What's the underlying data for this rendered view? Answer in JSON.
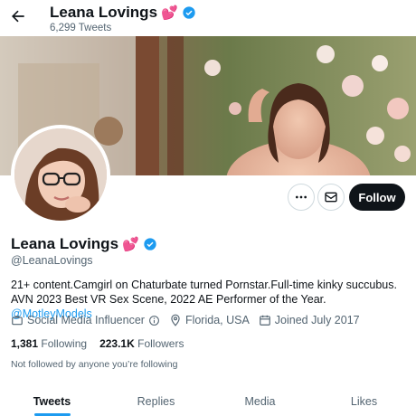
{
  "header": {
    "name": "Leana Lovings",
    "emoji": "💕",
    "tweet_count": "6,299 Tweets"
  },
  "actions": {
    "follow_label": "Follow"
  },
  "profile": {
    "name": "Leana Lovings",
    "emoji": "💕",
    "handle": "@LeanaLovings",
    "bio_text": "21+ content.Camgirl on Chaturbate turned Pornstar.Full-time kinky succubus. AVN 2023 Best VR Sex Scene, 2022 AE Performer of the Year. ",
    "bio_link": "@MotleyModels",
    "category": "Social Media Influencer",
    "location": "Florida, USA",
    "joined": "Joined July 2017",
    "following_count": "1,381",
    "following_label": "Following",
    "followers_count": "223.1K",
    "followers_label": "Followers",
    "not_followed_note": "Not followed by anyone you’re following"
  },
  "tabs": [
    {
      "label": "Tweets",
      "active": true
    },
    {
      "label": "Replies",
      "active": false
    },
    {
      "label": "Media",
      "active": false
    },
    {
      "label": "Likes",
      "active": false
    }
  ],
  "colors": {
    "accent": "#1d9bf0",
    "text": "#0f1419",
    "muted": "#536471"
  },
  "icons": [
    "back-arrow-icon",
    "verified-badge-icon",
    "more-icon",
    "mail-icon",
    "briefcase-icon",
    "info-icon",
    "location-pin-icon",
    "calendar-icon"
  ]
}
